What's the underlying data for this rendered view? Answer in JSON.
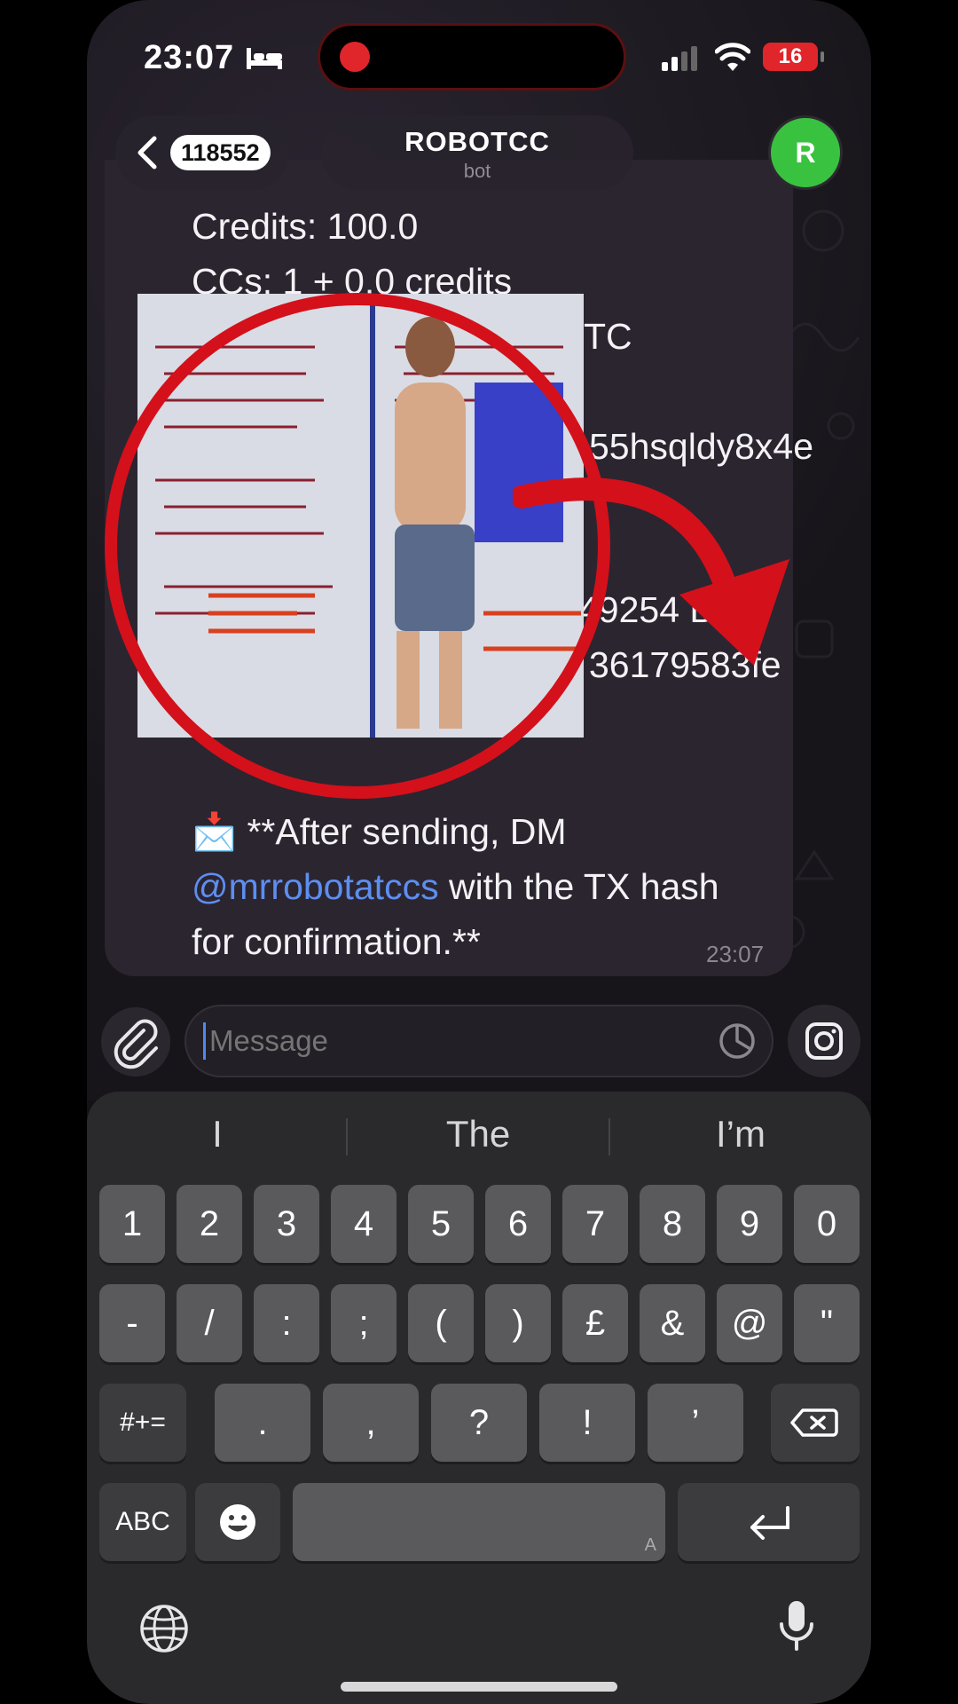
{
  "status_bar": {
    "time": "23:07",
    "battery": "16"
  },
  "header": {
    "back_count": "118552",
    "title": "ROBOTCC",
    "subtitle": "bot",
    "avatar_letter": "R"
  },
  "message": {
    "lines": [
      "Credits: 100.0",
      "CCs: 1 + 0.0 credits",
      "TC",
      "55hsqldy8x4e",
      "49254 BT",
      "36179583fe"
    ],
    "emoji": "📩",
    "note_part1": "**After sending, DM",
    "mention": "@mrrobotatccs",
    "note_part2": " with the TX hash",
    "note_part3": "for confirmation.**",
    "time": "23:07"
  },
  "input": {
    "placeholder": "Message"
  },
  "keyboard": {
    "suggestions": [
      "I",
      "The",
      "I’m"
    ],
    "row1": [
      "1",
      "2",
      "3",
      "4",
      "5",
      "6",
      "7",
      "8",
      "9",
      "0"
    ],
    "row2": [
      "-",
      "/",
      ":",
      ";",
      "(",
      ")",
      "£",
      "&",
      "@",
      "\""
    ],
    "row3_mode": "#+=",
    "row3": [
      ".",
      ",",
      "?",
      "!",
      "’"
    ],
    "abc": "ABC",
    "space_mark": "A"
  },
  "colors": {
    "accent_red": "#d4101b",
    "mention_blue": "#5d8ef0",
    "avatar_green": "#39c23f"
  }
}
